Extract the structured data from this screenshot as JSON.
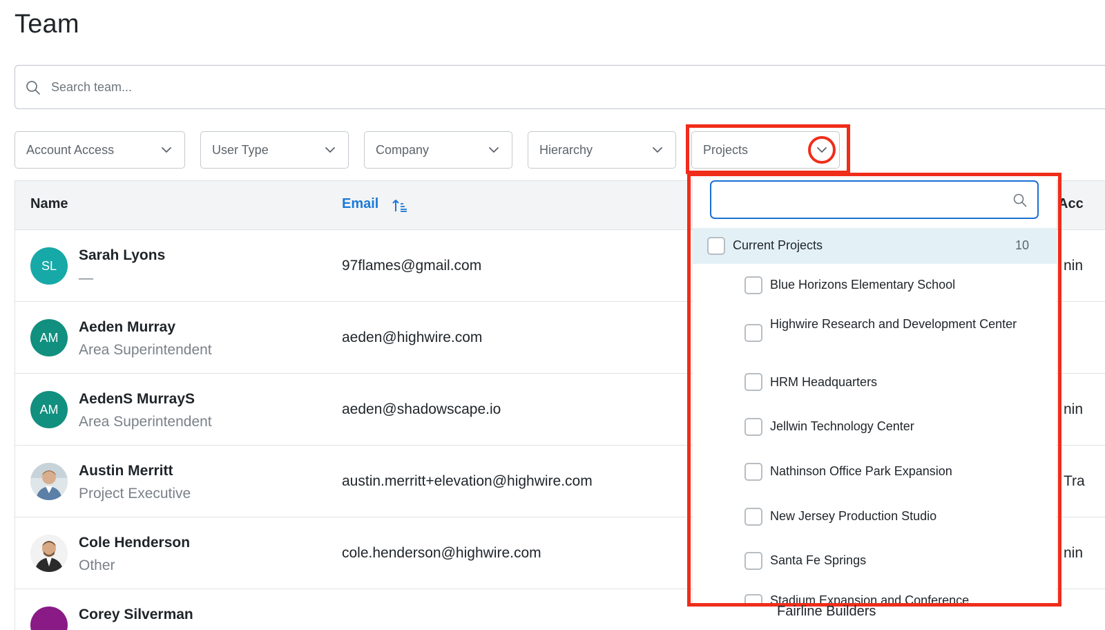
{
  "page": {
    "title": "Team"
  },
  "search": {
    "placeholder": "Search team..."
  },
  "filters": {
    "account_access": "Account Access",
    "user_type": "User Type",
    "company": "Company",
    "hierarchy": "Hierarchy",
    "projects": "Projects"
  },
  "table": {
    "headers": {
      "name": "Name",
      "email": "Email",
      "partial": "Acc"
    },
    "rows": [
      {
        "initials": "SL",
        "name": "Sarah Lyons",
        "role": "—",
        "email": "97flames@gmail.com",
        "extra": "nin"
      },
      {
        "initials": "AM",
        "name": "Aeden Murray",
        "role": "Area Superintendent",
        "email": "aeden@highwire.com",
        "extra": ""
      },
      {
        "initials": "AM",
        "name": "AedenS MurrayS",
        "role": "Area Superintendent",
        "email": "aeden@shadowscape.io",
        "extra": "nin"
      },
      {
        "initials": "",
        "name": "Austin Merritt",
        "role": "Project Executive",
        "email": "austin.merritt+elevation@highwire.com",
        "extra": "Tra"
      },
      {
        "initials": "",
        "name": "Cole Henderson",
        "role": "Other",
        "email": "cole.henderson@highwire.com",
        "extra": "nin"
      },
      {
        "initials": "",
        "name": "Corey Silverman",
        "role": "",
        "email": "",
        "extra": ""
      }
    ]
  },
  "projects_dropdown": {
    "search_value": "",
    "group": {
      "label": "Current Projects",
      "count": "10"
    },
    "items": [
      "Blue Horizons Elementary School",
      "Highwire Research and Development Center",
      "HRM Headquarters",
      "Jellwin Technology Center",
      "Nathinson Office Park Expansion",
      "New Jersey Production Studio",
      "Santa Fe Springs",
      "Stadium Expansion and Conference"
    ],
    "below_text": "Fairline Builders"
  },
  "colors": {
    "highlight": "#ef2d1a",
    "link_blue": "#1b79d8",
    "focus_blue": "#1a6fd4",
    "group_bg": "#e3f1f6"
  },
  "icons": {
    "search": "search-icon",
    "chevron": "chevron-down-icon",
    "sort": "sort-ascending-icon",
    "magnifier": "magnifier-icon"
  }
}
